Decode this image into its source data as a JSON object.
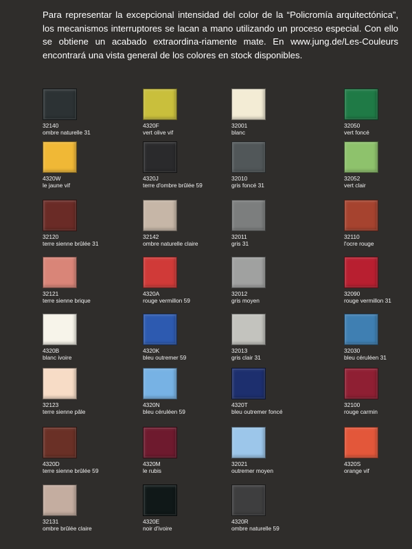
{
  "intro": "Para representar la excepcional intensidad del color de la “Policromía arquitectónica”, los mecanismos interruptores se lacan a mano utilizando un proceso especial. Con ello se obtiene un acabado extraordina-riamente mate. En www.jung.de/Les-Couleurs encontrará una vista general de los colores en stock disponibles.",
  "swatches": [
    {
      "code": "32140",
      "name": "ombre naturelle 31",
      "color": "#2c3234"
    },
    {
      "code": "4320F",
      "name": "vert olive vif",
      "color": "#c9bf3c"
    },
    {
      "code": "32001",
      "name": "blanc",
      "color": "#f3ecd5"
    },
    {
      "code": "32050",
      "name": "vert foncé",
      "color": "#1f7a46"
    },
    {
      "code": "4320W",
      "name": "le jaune vif",
      "color": "#f0b836"
    },
    {
      "code": "4320J",
      "name": "terre d'ombre brûlée 59",
      "color": "#2a2a2c"
    },
    {
      "code": "32010",
      "name": "gris foncé 31",
      "color": "#515759"
    },
    {
      "code": "32052",
      "name": "vert clair",
      "color": "#8ec26c"
    },
    {
      "code": "32120",
      "name": "terre sienne brûlée 31",
      "color": "#6a2b26"
    },
    {
      "code": "32142",
      "name": "ombre naturelle claire",
      "color": "#c6b6a7"
    },
    {
      "code": "32011",
      "name": "gris 31",
      "color": "#7c7e7e"
    },
    {
      "code": "32110",
      "name": "l'ocre rouge",
      "color": "#a6432f"
    },
    {
      "code": "32121",
      "name": "terre sienne brique",
      "color": "#d98578"
    },
    {
      "code": "4320A",
      "name": "rouge vermillon 59",
      "color": "#d03a38"
    },
    {
      "code": "32012",
      "name": "gris moyen",
      "color": "#a0a1a0"
    },
    {
      "code": "32090",
      "name": "rouge vermillon 31",
      "color": "#b81f30"
    },
    {
      "code": "4320B",
      "name": "blanc ivoire",
      "color": "#f7f4ea"
    },
    {
      "code": "4320K",
      "name": "bleu outremer 59",
      "color": "#2d5ab0"
    },
    {
      "code": "32013",
      "name": "gris clair 31",
      "color": "#c3c3be"
    },
    {
      "code": "32030",
      "name": "bleu céruléen 31",
      "color": "#3f7fb2"
    },
    {
      "code": "32123",
      "name": "terre sienne pâle",
      "color": "#f7dcc6"
    },
    {
      "code": "4320N",
      "name": "bleu céruléen 59",
      "color": "#77b2e4"
    },
    {
      "code": "4320T",
      "name": "bleu outremer foncé",
      "color": "#1d2f6e"
    },
    {
      "code": "32100",
      "name": "rouge carmin",
      "color": "#8f1f33"
    },
    {
      "code": "4320D",
      "name": "terre sienne brûlée 59",
      "color": "#6a3026"
    },
    {
      "code": "4320M",
      "name": "le rubis",
      "color": "#6e1a2e"
    },
    {
      "code": "32021",
      "name": "outremer moyen",
      "color": "#9cc6ea"
    },
    {
      "code": "4320S",
      "name": "orange vif",
      "color": "#e3573a"
    },
    {
      "code": "32131",
      "name": "ombre brûlée claire",
      "color": "#c4ada0"
    },
    {
      "code": "4320E",
      "name": "noir d'ivoire",
      "color": "#101818"
    },
    {
      "code": "4320R",
      "name": "ombre naturelle 59",
      "color": "#3e3e3f"
    }
  ]
}
